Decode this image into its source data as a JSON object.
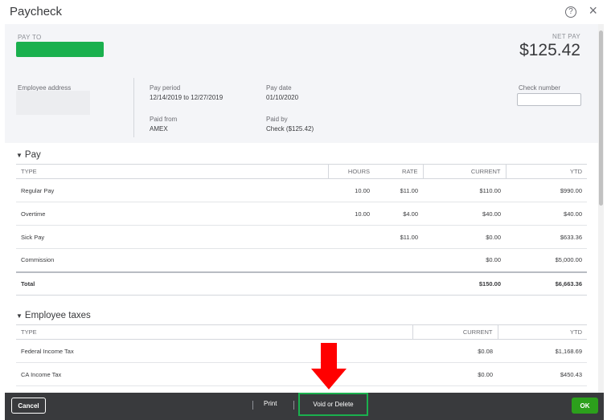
{
  "dialog": {
    "title": "Paycheck",
    "help_glyph": "?",
    "close_glyph": "×"
  },
  "summary": {
    "pay_to_label": "PAY TO",
    "net_pay_label": "NET PAY",
    "net_pay_value": "$125.42",
    "employee_address_label": "Employee address",
    "pay_period_label": "Pay period",
    "pay_period_value": "12/14/2019 to 12/27/2019",
    "pay_date_label": "Pay date",
    "pay_date_value": "01/10/2020",
    "paid_from_label": "Paid from",
    "paid_from_value": "AMEX",
    "paid_by_label": "Paid by",
    "paid_by_value": "Check ($125.42)",
    "check_number_label": "Check number",
    "check_number_value": ""
  },
  "pay": {
    "heading": "Pay",
    "columns": [
      "TYPE",
      "HOURS",
      "RATE",
      "CURRENT",
      "YTD"
    ],
    "rows": [
      {
        "type": "Regular Pay",
        "hours": "10.00",
        "rate": "$11.00",
        "current": "$110.00",
        "ytd": "$990.00"
      },
      {
        "type": "Overtime",
        "hours": "10.00",
        "rate": "$4.00",
        "current": "$40.00",
        "ytd": "$40.00"
      },
      {
        "type": "Sick Pay",
        "hours": "",
        "rate": "$11.00",
        "current": "$0.00",
        "ytd": "$633.36"
      },
      {
        "type": "Commission",
        "hours": "",
        "rate": "",
        "current": "$0.00",
        "ytd": "$5,000.00"
      }
    ],
    "total": {
      "type": "Total",
      "hours": "",
      "rate": "",
      "current": "$150.00",
      "ytd": "$6,663.36"
    }
  },
  "employee_taxes": {
    "heading": "Employee taxes",
    "columns": [
      "TYPE",
      "CURRENT",
      "YTD"
    ],
    "rows": [
      {
        "type": "Federal Income Tax",
        "current": "$0.08",
        "ytd": "$1,168.69"
      },
      {
        "type": "CA Income Tax",
        "current": "$0.00",
        "ytd": "$450.43"
      }
    ]
  },
  "footer": {
    "cancel_label": "Cancel",
    "print_label": "Print",
    "void_label": "Void or Delete",
    "ok_label": "OK"
  },
  "colors": {
    "accent_green": "#2ca01c",
    "highlight_green": "#1ab04e",
    "annotation_red": "#ff0000",
    "footer_bg": "#393a3d"
  }
}
